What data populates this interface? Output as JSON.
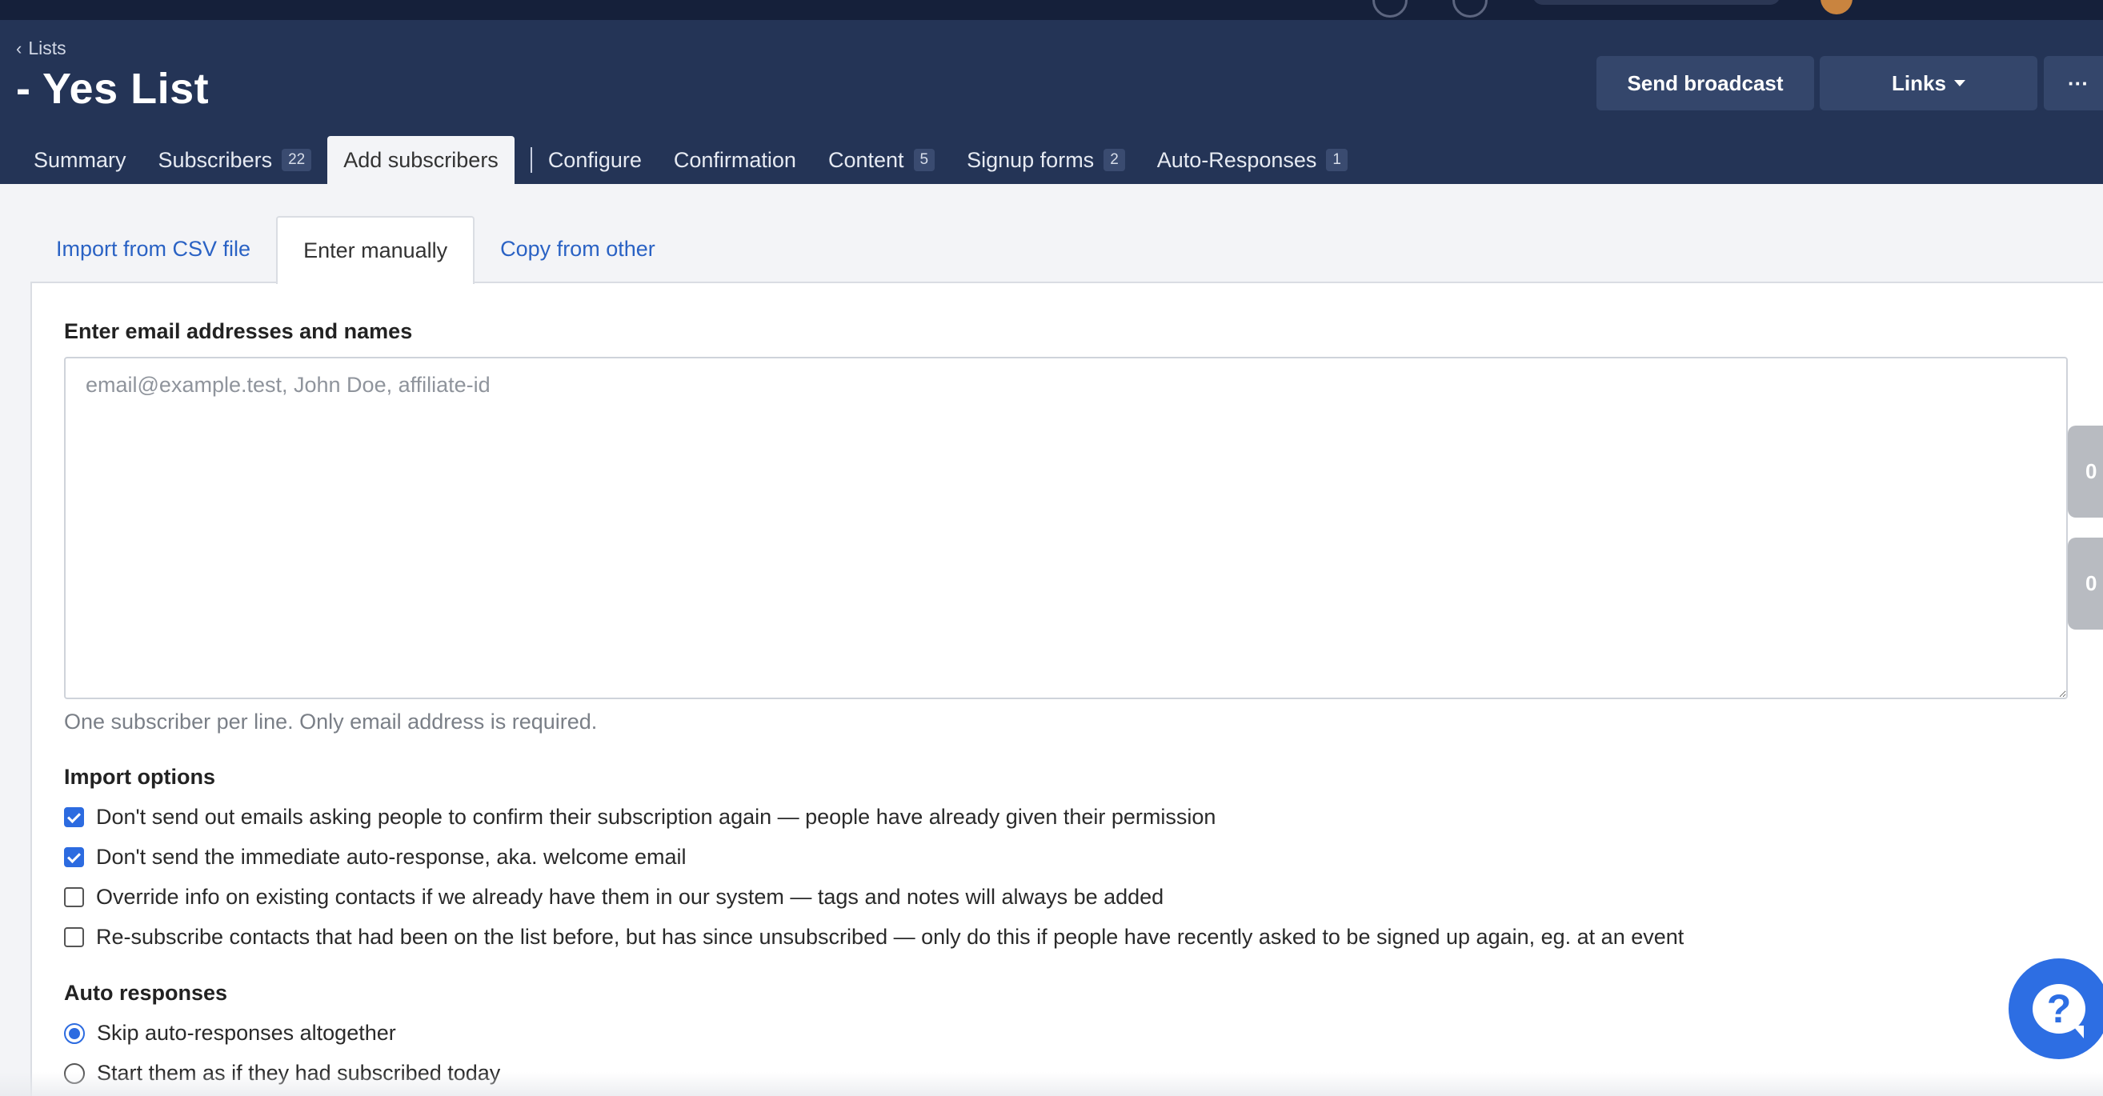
{
  "topbar": {
    "user_label": ""
  },
  "header": {
    "breadcrumb": "Lists",
    "title": "- Yes List",
    "send_broadcast": "Send broadcast",
    "links": "Links",
    "more": "···"
  },
  "main_tabs": [
    {
      "label": "Summary"
    },
    {
      "label": "Subscribers",
      "count": "22"
    },
    {
      "label": "Add subscribers",
      "active": true
    },
    {
      "label": "Configure"
    },
    {
      "label": "Confirmation"
    },
    {
      "label": "Content",
      "count": "5"
    },
    {
      "label": "Signup forms",
      "count": "2"
    },
    {
      "label": "Auto-Responses",
      "count": "1"
    }
  ],
  "sub_tabs": [
    {
      "label": "Import from CSV file"
    },
    {
      "label": "Enter manually",
      "active": true
    },
    {
      "label": "Copy from other"
    }
  ],
  "form": {
    "email_label": "Enter email addresses and names",
    "email_placeholder": "email@example.test, John Doe, affiliate-id",
    "email_value": "",
    "helper": "One subscriber per line. Only email address is required.",
    "import_options_label": "Import options",
    "import_options": [
      {
        "label": "Don't send out emails asking people to confirm their subscription again — people have already given their permission",
        "checked": true
      },
      {
        "label": "Don't send the immediate auto-response, aka. welcome email",
        "checked": true
      },
      {
        "label": "Override info on existing contacts if we already have them in our system — tags and notes will always be added",
        "checked": false
      },
      {
        "label": "Re-subscribe contacts that had been on the list before, but has since unsubscribed — only do this if people have recently asked to be signed up again, eg. at an event",
        "checked": false
      }
    ],
    "auto_responses_label": "Auto responses",
    "auto_responses": [
      {
        "label": "Skip auto-responses altogether",
        "selected": true
      },
      {
        "label": "Start them as if they had subscribed today",
        "selected": false
      }
    ]
  },
  "side_chips": [
    "0",
    "0"
  ],
  "help": "?",
  "colors": {
    "topbar": "#15203a",
    "header": "#243456",
    "accent": "#2c6be0",
    "link": "#2a62c4"
  }
}
